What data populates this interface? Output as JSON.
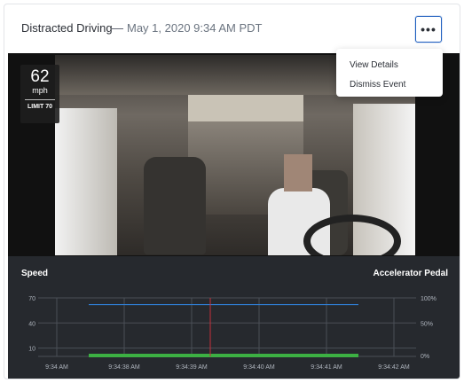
{
  "header": {
    "title": "Distracted Driving",
    "separator": "—",
    "date": "May 1, 2020 9:34 AM PDT"
  },
  "menu": {
    "button_label": "•••",
    "items": [
      "View Details",
      "Dismiss Event"
    ]
  },
  "speed_overlay": {
    "speed": "62",
    "unit": "mph",
    "limit": "LIMIT 70"
  },
  "chart_data": {
    "type": "line",
    "left_label": "Speed",
    "right_label": "Accelerator Pedal",
    "y_left_ticks": [
      70,
      40,
      10
    ],
    "y_right_ticks": [
      "100%",
      "50%",
      "0%"
    ],
    "x_ticks": [
      "9:34 AM",
      "9:34:38 AM",
      "9:34:39 AM",
      "9:34:40 AM",
      "9:34:41 AM",
      "9:34:42 AM"
    ],
    "ylim": [
      0,
      70
    ],
    "series": [
      {
        "values": [
          62,
          62
        ],
        "color": "#2f7fd6"
      },
      {
        "values": [
          1,
          1
        ],
        "color": "#3cb043"
      }
    ],
    "marker_color": "#c62f3a",
    "grid_color": "#4a4f57"
  }
}
